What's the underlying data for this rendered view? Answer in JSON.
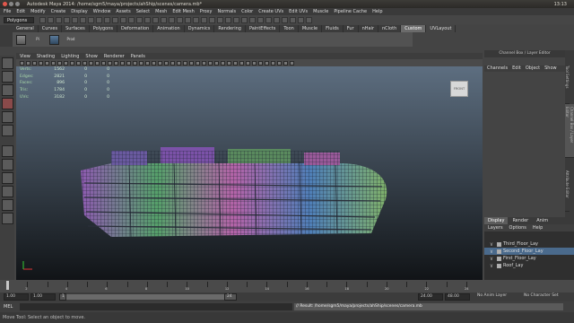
{
  "window": {
    "title": "Autodesk Maya 2014: /home/sgm5/maya/projects/ahShip/scenes/camera.mb*",
    "clock": "13:13"
  },
  "menu": [
    "File",
    "Edit",
    "Modify",
    "Create",
    "Display",
    "Window",
    "Assets",
    "Select",
    "Mesh",
    "Edit Mesh",
    "Proxy",
    "Normals",
    "Color",
    "Create UVs",
    "Edit UVs",
    "Muscle",
    "Pipeline Cache",
    "Help"
  ],
  "status": {
    "mode": "Polygons"
  },
  "shelf": {
    "tabs": [
      "General",
      "Curves",
      "Surfaces",
      "Polygons",
      "Deformation",
      "Animation",
      "Dynamics",
      "Rendering",
      "PaintEffects",
      "Toon",
      "Muscle",
      "Fluids",
      "Fur",
      "nHair",
      "nCloth",
      "Custom",
      "UVLayout"
    ],
    "active": "Custom",
    "items": [
      {
        "label": "Pi"
      },
      {
        "label": "Prod"
      }
    ]
  },
  "panel": {
    "menu": [
      "View",
      "Shading",
      "Lighting",
      "Show",
      "Renderer",
      "Panels"
    ]
  },
  "hud": [
    {
      "label": "Verts:",
      "a": "1562",
      "b": "0",
      "c": "0"
    },
    {
      "label": "Edges:",
      "a": "2821",
      "b": "0",
      "c": "0"
    },
    {
      "label": "Faces:",
      "a": "896",
      "b": "0",
      "c": "0"
    },
    {
      "label": "Tris:",
      "a": "1784",
      "b": "0",
      "c": "0"
    },
    {
      "label": "UVs:",
      "a": "3182",
      "b": "0",
      "c": "0"
    }
  ],
  "viewcube": {
    "label": "FRONT"
  },
  "channel_box": {
    "title": "Channel Box / Layer Editor",
    "menu": [
      "Channels",
      "Edit",
      "Object",
      "Show"
    ]
  },
  "side_tabs": [
    "Tool Settings",
    "Channel Box / Layer Editor",
    "Attribute Editor"
  ],
  "layer_editor": {
    "tabs": [
      "Display",
      "Render",
      "Anim"
    ],
    "active_tab": "Display",
    "menu": [
      "Layers",
      "Options",
      "Help"
    ],
    "layers": [
      {
        "v": "V",
        "name": "Third_Floor_Lay",
        "selected": false,
        "color": "#b0b0b0"
      },
      {
        "v": "V",
        "name": "Second_Floor_Lay",
        "selected": true,
        "color": "#b0b0b0"
      },
      {
        "v": "V",
        "name": "First_Floor_Lay",
        "selected": false,
        "color": "#b0b0b0"
      },
      {
        "v": "V",
        "name": "Roof_Lay",
        "selected": false,
        "color": "#b0b0b0"
      }
    ]
  },
  "timeline": {
    "labels": [
      "1",
      "3"
    ],
    "marks": [
      "2",
      "4",
      "6",
      "8",
      "10",
      "12",
      "14",
      "16",
      "18",
      "20",
      "22",
      "24"
    ],
    "current": "1"
  },
  "range": {
    "start": "1.00",
    "current_field": "1.00",
    "current_frame": "1",
    "end_slider": "24",
    "end": "24.00",
    "total": "48.00",
    "anim_layer": "No Anim Layer",
    "char_set": "No Character Set"
  },
  "mel": {
    "label": "MEL",
    "result": "// Result: /home/sgm5/maya/projects/ahShip/scenes/camera.mb"
  },
  "help": "Move Tool: Select an object to move."
}
